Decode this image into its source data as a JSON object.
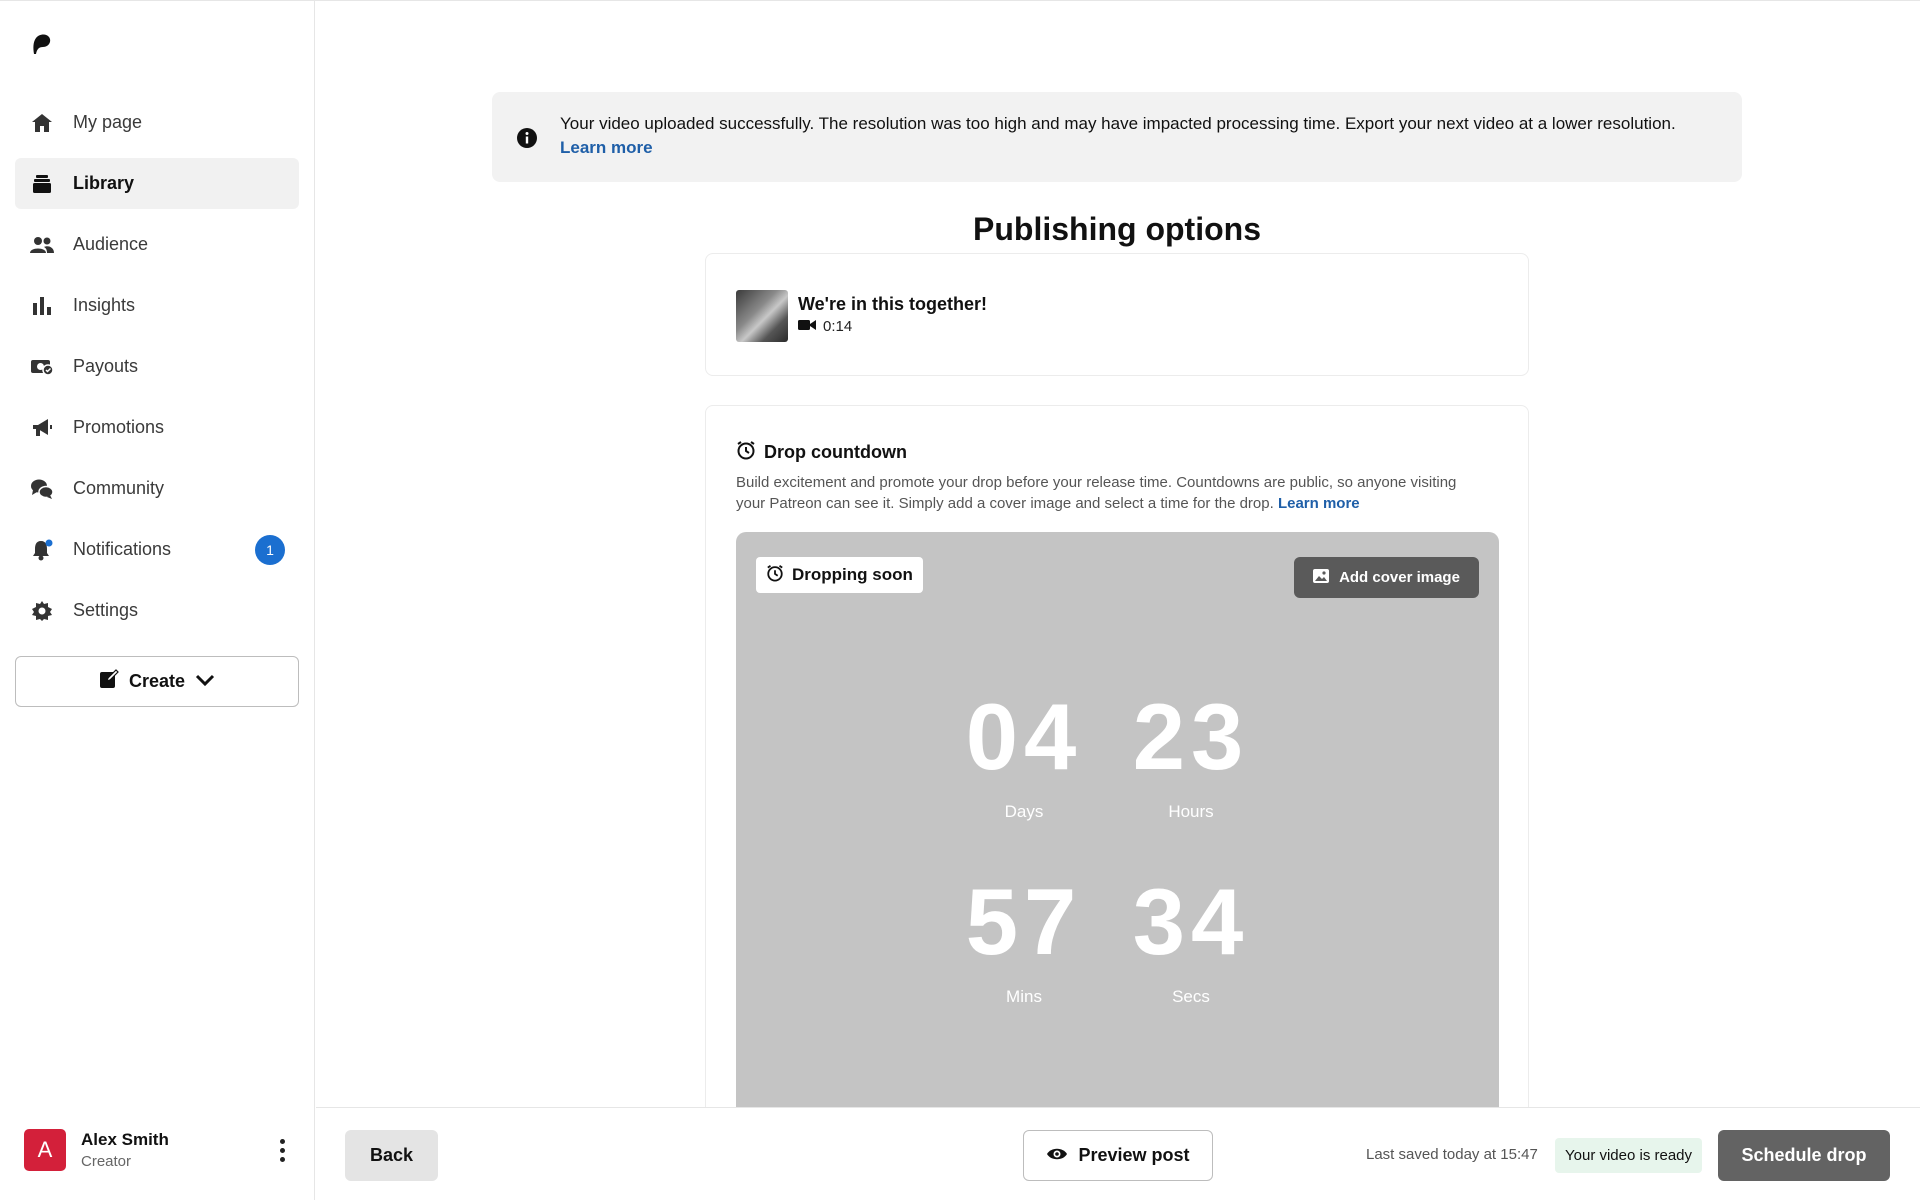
{
  "sidebar": {
    "logo_icon": "patreon-logo-icon",
    "items": [
      {
        "label": "My page",
        "icon": "home-icon"
      },
      {
        "label": "Library",
        "icon": "library-icon"
      },
      {
        "label": "Audience",
        "icon": "audience-icon"
      },
      {
        "label": "Insights",
        "icon": "insights-icon"
      },
      {
        "label": "Payouts",
        "icon": "payouts-icon"
      },
      {
        "label": "Promotions",
        "icon": "megaphone-icon"
      },
      {
        "label": "Community",
        "icon": "chat-icon"
      },
      {
        "label": "Notifications",
        "icon": "bell-icon",
        "badge": "1"
      },
      {
        "label": "Settings",
        "icon": "gear-icon"
      }
    ],
    "create_label": "Create",
    "user": {
      "initial": "A",
      "name": "Alex Smith",
      "role": "Creator"
    }
  },
  "banner": {
    "text": "Your video uploaded successfully. The resolution was too high and may have impacted processing time. Export your next video at a lower resolution.",
    "link": "Learn more"
  },
  "main": {
    "title": "Publishing options",
    "post": {
      "title": "We're in this together!",
      "duration": "0:14"
    },
    "drop": {
      "title": "Drop countdown",
      "description": "Build excitement and promote your drop before your release time. Countdowns are public, so anyone visiting your Patreon can see it. Simply add a cover image and select a time for the drop.",
      "link": "Learn more",
      "pill": "Dropping soon",
      "cover_button": "Add cover image",
      "days": "04",
      "days_label": "Days",
      "hours": "23",
      "hours_label": "Hours",
      "mins": "57",
      "mins_label": "Mins",
      "secs": "34",
      "secs_label": "Secs"
    }
  },
  "footer": {
    "back": "Back",
    "preview": "Preview post",
    "saved": "Last saved today at 15:47",
    "status": "Your video is ready",
    "schedule": "Schedule drop"
  },
  "colors": {
    "accent_blue": "#1b6fd0",
    "avatar_red": "#d3203a",
    "ready_bg": "#e7f5ec"
  }
}
